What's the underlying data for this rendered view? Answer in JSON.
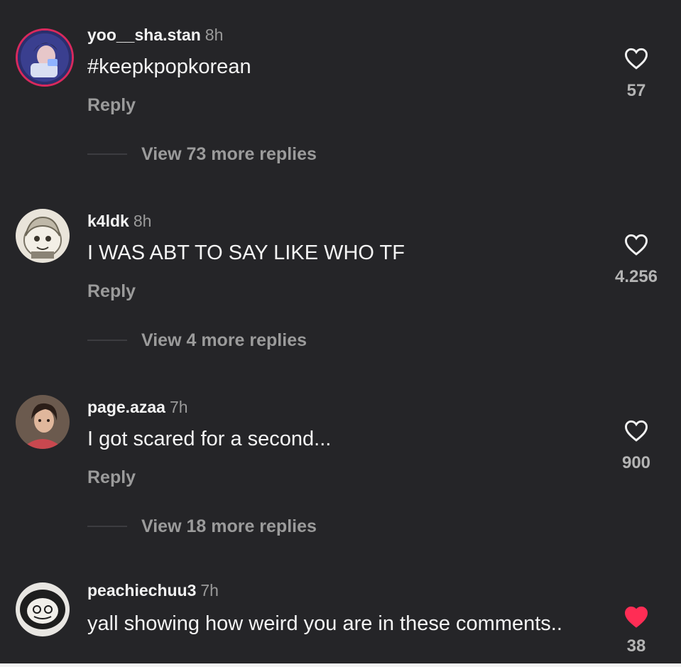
{
  "comments": [
    {
      "username": "yoo__sha.stan",
      "time": "8h",
      "text": "#keepkpopkorean",
      "reply_label": "Reply",
      "view_replies": "View 73 more replies",
      "likes": "57",
      "liked": false,
      "avatar": "profile-photo-with-story-ring"
    },
    {
      "username": "k4ldk",
      "time": "8h",
      "text": "I WAS ABT TO SAY LIKE WHO TF",
      "reply_label": "Reply",
      "view_replies": "View 4 more replies",
      "likes": "4.256",
      "liked": false,
      "avatar": "cartoon-character-avatar"
    },
    {
      "username": "page.azaa",
      "time": "7h",
      "text": "I got scared for a second...",
      "reply_label": "Reply",
      "view_replies": "View 18 more replies",
      "likes": "900",
      "liked": false,
      "avatar": "profile-photo"
    },
    {
      "username": "peachiechuu3",
      "time": "7h",
      "text": "yall showing how weird you are in these comments..",
      "reply_label": "",
      "view_replies": "",
      "likes": "38",
      "liked": true,
      "avatar": "doodle-avatar"
    }
  ],
  "colors": {
    "background": "#252528",
    "primary_text": "#f2f2f2",
    "secondary_text": "#9b9b9b",
    "liked_heart": "#ff2d55",
    "story_ring": "#e1306c"
  }
}
